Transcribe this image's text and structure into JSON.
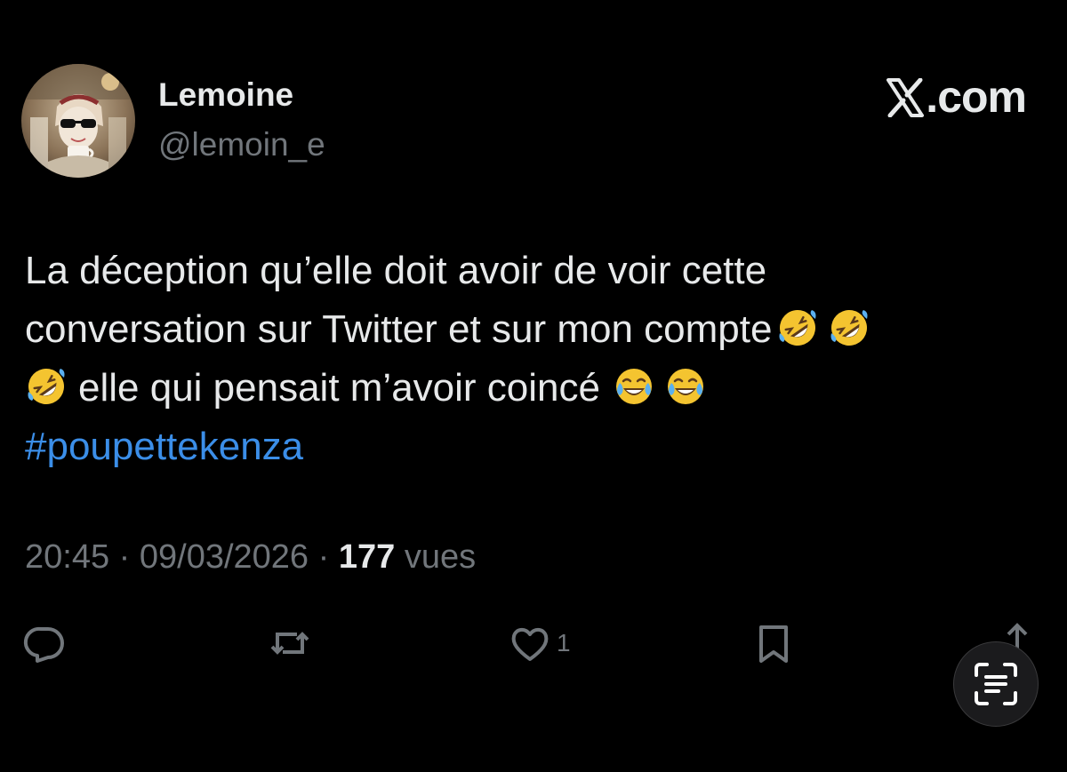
{
  "author": {
    "display_name": "Lemoine",
    "handle": "@lemoin_e",
    "avatar_icon": "profile-avatar-photo"
  },
  "brand": {
    "label": ".com",
    "icon": "x-logo-icon"
  },
  "tweet": {
    "line1": "La déception qu’elle doit avoir de voir cette",
    "line2": "conversation sur Twitter et sur mon compte",
    "line3": "elle qui pensait m’avoir coincé",
    "hashtag": "#poupettekenza",
    "emojis": [
      "rolling-on-floor-laughing",
      "rolling-on-floor-laughing",
      "rolling-on-floor-laughing",
      "face-with-tears-of-joy",
      "face-with-tears-of-joy"
    ]
  },
  "meta": {
    "time": "20:45",
    "separator": "·",
    "date": "09/03/2026",
    "views_count": "177",
    "views_label": "vues"
  },
  "actions": {
    "reply_icon": "reply-icon",
    "retweet_icon": "retweet-icon",
    "like_icon": "heart-icon",
    "like_count": "1",
    "bookmark_icon": "bookmark-icon",
    "share_icon": "share-icon"
  },
  "overlay": {
    "scan_icon": "live-text-scan-icon"
  },
  "colors": {
    "background": "#000000",
    "primary_text": "#e7e9ea",
    "secondary_text": "#71767b",
    "hashtag": "#3b8ee8"
  }
}
